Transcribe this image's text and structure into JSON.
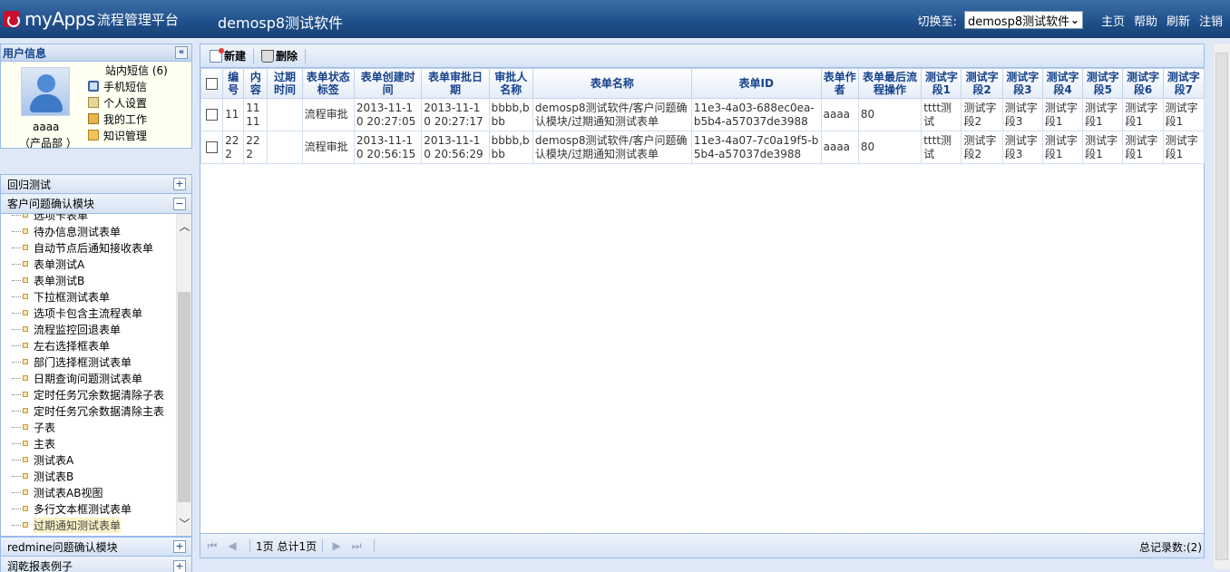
{
  "header": {
    "logo_text": "myApps",
    "logo_sub": "流程管理平台",
    "app_name": "demosp8测试软件",
    "switch_label": "切换至:",
    "switch_value": "demosp8测试软件",
    "links": [
      "主页",
      "帮助",
      "刷新",
      "注销"
    ]
  },
  "userinfo": {
    "title": "用户信息",
    "username": "aaaa",
    "dept": "（产品部 ）",
    "links": [
      "站内短信 (6)",
      "手机短信",
      "个人设置",
      "我的工作",
      "知识管理"
    ]
  },
  "modules": {
    "m1": "回归测试",
    "m2": "客户问题确认模块",
    "m3": "redmine问题确认模块",
    "m4": "润乾报表例子"
  },
  "tree_items": [
    "选项卡表单",
    "待办信息测试表单",
    "自动节点后通知接收表单",
    "表单测试A",
    "表单测试B",
    "下拉框测试表单",
    "选项卡包含主流程表单",
    "流程监控回退表单",
    "左右选择框表单",
    "部门选择框测试表单",
    "日期查询问题测试表单",
    "定时任务冗余数据清除子表",
    "定时任务冗余数据清除主表",
    "子表",
    "主表",
    "测试表A",
    "测试表B",
    "测试表AB视图",
    "多行文本框测试表单",
    "过期通知测试表单"
  ],
  "toolbar": {
    "new_label": "新建",
    "delete_label": "删除"
  },
  "table": {
    "headers": [
      "编号",
      "内容",
      "过期时间",
      "表单状态标签",
      "表单创建时间",
      "表单审批日期",
      "审批人名称",
      "表单名称",
      "表单ID",
      "表单作者",
      "表单最后流程操作",
      "测试字段1",
      "测试字段2",
      "测试字段3",
      "测试字段4",
      "测试字段5",
      "测试字段6",
      "测试字段7"
    ],
    "rows": [
      [
        "11",
        "1111",
        "",
        "流程审批",
        "2013-11-10 20:27:05",
        "2013-11-10 20:27:17",
        "bbbb,bbb",
        "demosp8测试软件/客户问题确认模块/过期通知测试表单",
        "11e3-4a03-688ec0ea-b5b4-a57037de3988",
        "aaaa",
        "80",
        "tttt测试",
        "测试字段2",
        "测试字段3",
        "测试字段1",
        "测试字段1",
        "测试字段1",
        "测试字段1"
      ],
      [
        "222",
        "222",
        "",
        "流程审批",
        "2013-11-10 20:56:15",
        "2013-11-10 20:56:29",
        "bbbb,bbb",
        "demosp8测试软件/客户问题确认模块/过期通知测试表单",
        "11e3-4a07-7c0a19f5-b5b4-a57037de3988",
        "aaaa",
        "80",
        "tttt测试",
        "测试字段2",
        "测试字段3",
        "测试字段1",
        "测试字段1",
        "测试字段1",
        "测试字段1"
      ]
    ]
  },
  "pager": {
    "page_text": "1页 总计1页",
    "total_text": "总记录数:(2)"
  }
}
